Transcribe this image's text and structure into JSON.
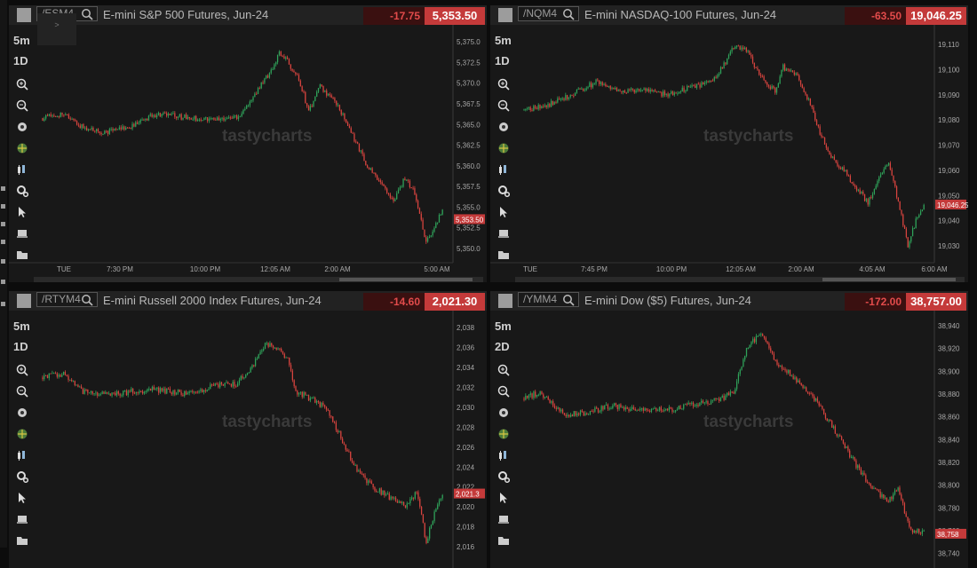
{
  "colors": {
    "up": "#2fa35a",
    "down": "#d8443f",
    "price_box": "#c43a3a",
    "change_box": "#3a1010",
    "change_text": "#e24b4b"
  },
  "toolbar_icons": [
    "zoom-in-icon",
    "zoom-out-icon",
    "indicator-icon",
    "drawing-icon",
    "chart-type-icon",
    "settings-icon",
    "cursor-icon",
    "layout-icon",
    "folder-icon"
  ],
  "watermark": "tastycharts",
  "expand_glyph": ">",
  "panels": [
    {
      "symbol": "/ESM4",
      "title": "E-mini S&P 500 Futures, Jun-24",
      "change": "-17.75",
      "last": "5,353.50",
      "interval": "5m",
      "range": "1D",
      "last_tag": "5,353.50",
      "y_ticks": [
        "5,375.0",
        "5,372.5",
        "5,370.0",
        "5,367.5",
        "5,365.0",
        "5,362.5",
        "5,360.0",
        "5,357.5",
        "5,355.0",
        "5,352.5",
        "5,350.0"
      ],
      "x_ticks": [
        "TUE",
        "7:30 PM",
        "10:00 PM",
        "12:05 AM",
        "2:00 AM",
        "5:00 AM"
      ],
      "chart_data": {
        "type": "candlestick",
        "title": "E-mini S&P 500 Futures, Jun-24",
        "ylim": [
          5348.5,
          5376.2
        ],
        "path": [
          [
            0,
            5365.8
          ],
          [
            12,
            5366.3
          ],
          [
            25,
            5364.6
          ],
          [
            38,
            5364.1
          ],
          [
            55,
            5364.8
          ],
          [
            70,
            5366.3
          ],
          [
            90,
            5365.8
          ],
          [
            108,
            5365.6
          ],
          [
            120,
            5366.0
          ],
          [
            130,
            5368.6
          ],
          [
            140,
            5371.6
          ],
          [
            145,
            5373.6
          ],
          [
            150,
            5372.6
          ],
          [
            157,
            5370.6
          ],
          [
            163,
            5366.6
          ],
          [
            170,
            5369.6
          ],
          [
            180,
            5367.6
          ],
          [
            190,
            5363.6
          ],
          [
            200,
            5359.6
          ],
          [
            205,
            5358.6
          ],
          [
            215,
            5355.6
          ],
          [
            222,
            5358.6
          ],
          [
            228,
            5356.8
          ],
          [
            235,
            5350.6
          ],
          [
            240,
            5352.8
          ],
          [
            245,
            5354.5
          ]
        ]
      }
    },
    {
      "symbol": "/NQM4",
      "title": "E-mini NASDAQ-100 Futures, Jun-24",
      "change": "-63.50",
      "last": "19,046.25",
      "interval": "5m",
      "range": "1D",
      "last_tag": "19,046.25",
      "y_ticks": [
        "19,110",
        "19,100",
        "19,090",
        "19,080",
        "19,070",
        "19,060",
        "19,050",
        "19,040",
        "19,030"
      ],
      "x_ticks": [
        "TUE",
        "7:45 PM",
        "10:00 PM",
        "12:05 AM",
        "2:00 AM",
        "4:05 AM",
        "6:00 AM"
      ],
      "chart_data": {
        "type": "candlestick",
        "title": "E-mini NASDAQ-100 Futures, Jun-24",
        "ylim": [
          19024,
          19115
        ],
        "path": [
          [
            0,
            19084
          ],
          [
            15,
            19086
          ],
          [
            30,
            19090
          ],
          [
            45,
            19095
          ],
          [
            60,
            19091
          ],
          [
            75,
            19092
          ],
          [
            90,
            19090
          ],
          [
            105,
            19093
          ],
          [
            118,
            19095
          ],
          [
            125,
            19102
          ],
          [
            132,
            19110
          ],
          [
            140,
            19107
          ],
          [
            148,
            19097
          ],
          [
            157,
            19091
          ],
          [
            162,
            19101
          ],
          [
            170,
            19098
          ],
          [
            178,
            19088
          ],
          [
            185,
            19075
          ],
          [
            192,
            19065
          ],
          [
            200,
            19060
          ],
          [
            208,
            19053
          ],
          [
            215,
            19047
          ],
          [
            222,
            19057
          ],
          [
            228,
            19063
          ],
          [
            235,
            19045
          ],
          [
            240,
            19030
          ],
          [
            245,
            19040
          ],
          [
            250,
            19046
          ]
        ]
      }
    },
    {
      "symbol": "/RTYM4",
      "title": "E-mini Russell 2000 Index Futures, Jun-24",
      "change": "-14.60",
      "last": "2,021.30",
      "interval": "5m",
      "range": "1D",
      "last_tag": "2,021.3",
      "y_ticks": [
        "2,038",
        "2,036",
        "2,034",
        "2,032",
        "2,030",
        "2,028",
        "2,026",
        "2,024",
        "2,022",
        "2,020",
        "2,018",
        "2,016"
      ],
      "x_ticks": [],
      "chart_data": {
        "type": "candlestick",
        "title": "E-mini Russell 2000 Index Futures, Jun-24",
        "ylim": [
          2014.4,
          2039.0
        ],
        "path": [
          [
            0,
            2033.0
          ],
          [
            12,
            2033.4
          ],
          [
            25,
            2031.6
          ],
          [
            40,
            2031.2
          ],
          [
            55,
            2031.6
          ],
          [
            70,
            2031.8
          ],
          [
            90,
            2031.4
          ],
          [
            108,
            2032.2
          ],
          [
            120,
            2032.4
          ],
          [
            130,
            2034.0
          ],
          [
            138,
            2036.4
          ],
          [
            145,
            2036.0
          ],
          [
            152,
            2035.0
          ],
          [
            157,
            2031.6
          ],
          [
            165,
            2031.0
          ],
          [
            175,
            2030.0
          ],
          [
            185,
            2027.0
          ],
          [
            195,
            2023.6
          ],
          [
            205,
            2022.0
          ],
          [
            215,
            2021.0
          ],
          [
            225,
            2020.0
          ],
          [
            232,
            2021.6
          ],
          [
            238,
            2016.4
          ],
          [
            243,
            2019.5
          ],
          [
            248,
            2021.3
          ]
        ]
      }
    },
    {
      "symbol": "/YMM4",
      "title": "E-mini Dow ($5) Futures, Jun-24",
      "change": "-172.00",
      "last": "38,757.00",
      "interval": "5m",
      "range": "2D",
      "last_tag": "38,758",
      "y_ticks": [
        "38,940",
        "38,920",
        "38,900",
        "38,880",
        "38,860",
        "38,840",
        "38,820",
        "38,800",
        "38,780",
        "38,760",
        "38,740"
      ],
      "x_ticks": [],
      "chart_data": {
        "type": "candlestick",
        "title": "E-mini Dow ($5) Futures, Jun-24",
        "ylim": [
          38732,
          38947
        ],
        "path": [
          [
            0,
            38876
          ],
          [
            10,
            38882
          ],
          [
            25,
            38862
          ],
          [
            40,
            38864
          ],
          [
            55,
            38870
          ],
          [
            70,
            38866
          ],
          [
            90,
            38866
          ],
          [
            108,
            38872
          ],
          [
            120,
            38874
          ],
          [
            130,
            38882
          ],
          [
            138,
            38918
          ],
          [
            145,
            38932
          ],
          [
            150,
            38928
          ],
          [
            157,
            38904
          ],
          [
            165,
            38898
          ],
          [
            172,
            38888
          ],
          [
            182,
            38872
          ],
          [
            192,
            38850
          ],
          [
            205,
            38820
          ],
          [
            215,
            38798
          ],
          [
            225,
            38786
          ],
          [
            232,
            38796
          ],
          [
            240,
            38760
          ],
          [
            248,
            38758
          ]
        ]
      }
    }
  ]
}
